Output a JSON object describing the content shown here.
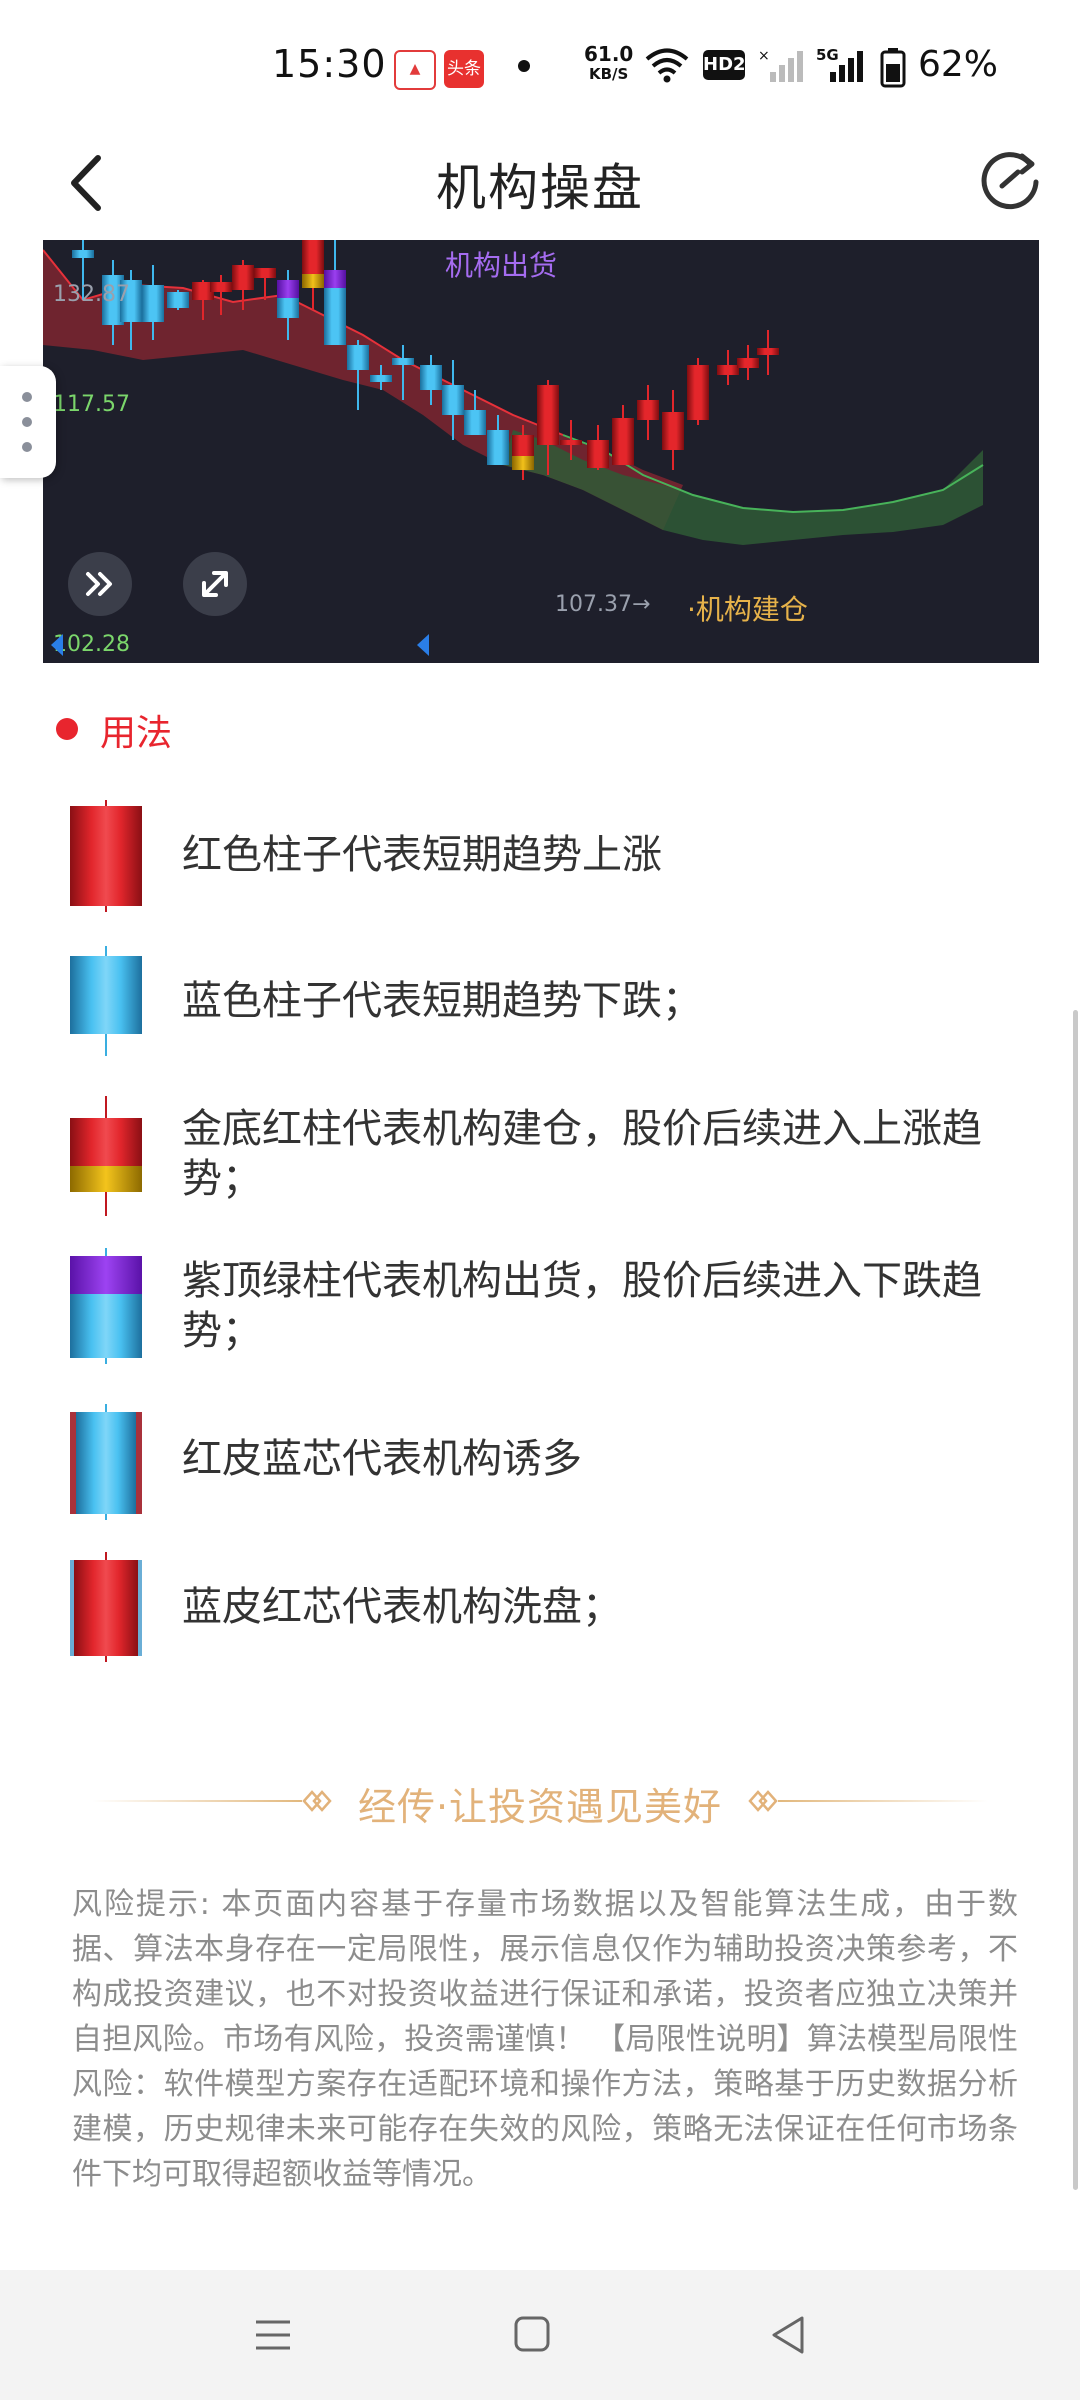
{
  "status_bar": {
    "time": "15:30",
    "app_badge": "头条",
    "net_speed_value": "61.0",
    "net_speed_unit": "KB/S",
    "hd_badge": "HD2",
    "network_type": "5G",
    "battery": "62%"
  },
  "header": {
    "title": "机构操盘"
  },
  "chart": {
    "price_labels": [
      "132.87",
      "117.57",
      "102.28"
    ],
    "low_marker": "107.37→",
    "annotation_sell": "机构出货",
    "annotation_buy": "·机构建仓",
    "colors": {
      "background": "#1e1f2b",
      "up": "#e1262b",
      "down": "#3fb8ee",
      "gold": "#e6b000",
      "purple": "#8f2fe8"
    }
  },
  "usage": {
    "title": "用法",
    "items": [
      {
        "candle": "red",
        "text": "红色柱子代表短期趋势上涨"
      },
      {
        "candle": "blue",
        "text": "蓝色柱子代表短期趋势下跌；"
      },
      {
        "candle": "gold-bottom-red",
        "text": "金底红柱代表机构建仓，股价后续进入上涨趋势；"
      },
      {
        "candle": "purple-top-blue",
        "text": "紫顶绿柱代表机构出货，股价后续进入下跌趋势；"
      },
      {
        "candle": "red-skin-blue-core",
        "text": "红皮蓝芯代表机构诱多"
      },
      {
        "candle": "blue-skin-red-core",
        "text": "蓝皮红芯代表机构洗盘；"
      }
    ]
  },
  "slogan": "经传·让投资遇见美好",
  "risk_notice": "风险提示: 本页面内容基于存量市场数据以及智能算法生成，由于数据、算法本身存在一定局限性，展示信息仅作为辅助投资决策参考，不构成投资建议，也不对投资收益进行保证和承诺，投资者应独立决策并自担风险。市场有风险，投资需谨慎！ 【局限性说明】算法模型局限性风险：软件模型方案存在适配环境和操作方法，策略基于历史数据分析建模，历史规律未来可能存在失效的风险，策略无法保证在任何市场条件下均可取得超额收益等情况。"
}
